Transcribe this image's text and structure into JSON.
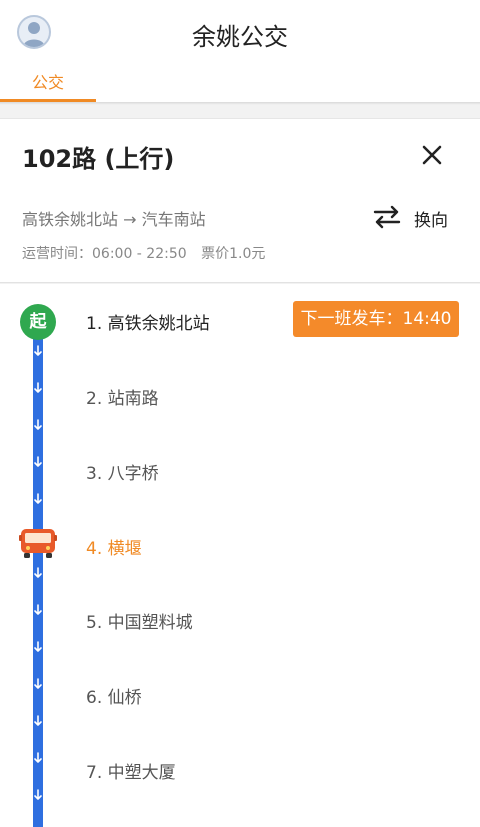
{
  "header": {
    "title": "余姚公交",
    "avatar_icon": "user-avatar-icon"
  },
  "tabs": [
    {
      "label": "公交",
      "active": true
    }
  ],
  "route": {
    "name": "102路 (上行)",
    "direction": "高铁余姚北站 → 汽车南站",
    "switch_label": "换向",
    "hours": "运营时间：06:00 - 22:50",
    "fare": "票价1.0元"
  },
  "line": {
    "start_badge": "起",
    "next_departure": "下一班发车：14:40",
    "stops": [
      {
        "label": "1. 高铁余姚北站",
        "state": "first"
      },
      {
        "label": "2. 站南路",
        "state": "normal"
      },
      {
        "label": "3. 八字桥",
        "state": "normal"
      },
      {
        "label": "4. 横堰",
        "state": "current"
      },
      {
        "label": "5. 中国塑料城",
        "state": "normal"
      },
      {
        "label": "6. 仙桥",
        "state": "normal"
      },
      {
        "label": "7. 中塑大厦",
        "state": "normal"
      }
    ],
    "colors": {
      "track": "#2f6fe0",
      "current": "#f08a24",
      "start": "#2fa84f"
    }
  }
}
